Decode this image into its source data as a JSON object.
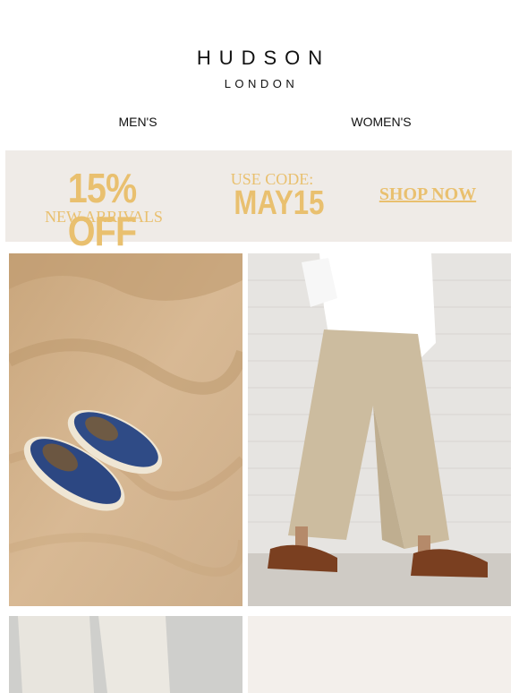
{
  "brand": {
    "name": "HUDSON",
    "sub": "LONDON"
  },
  "nav": {
    "men": "MEN'S",
    "women": "WOMEN'S"
  },
  "promo": {
    "headline": "15% OFF",
    "subline": "NEW ARRIVALS",
    "code_label": "USE CODE:",
    "code": "MAY15",
    "cta": "SHOP NOW",
    "accent_color": "#e9c06f",
    "background_color": "#efebe7"
  },
  "tiles": [
    {
      "icon": "espadrille-shoes-on-sand-photo"
    },
    {
      "icon": "linen-trousers-sandals-photo"
    },
    {
      "icon": "linen-trousers-detail-photo"
    },
    {
      "icon": "blank-placeholder-photo"
    }
  ]
}
